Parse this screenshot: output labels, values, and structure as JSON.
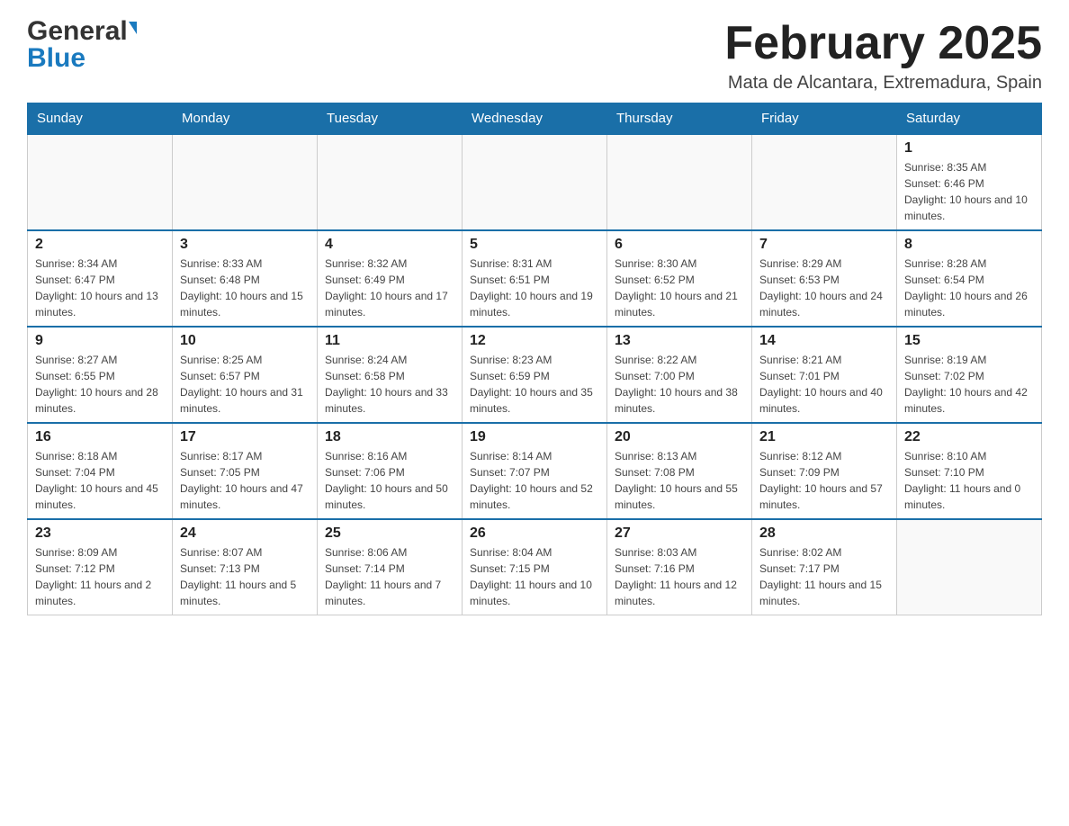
{
  "header": {
    "logo_general": "General",
    "logo_blue": "Blue",
    "month_title": "February 2025",
    "location": "Mata de Alcantara, Extremadura, Spain"
  },
  "weekdays": [
    "Sunday",
    "Monday",
    "Tuesday",
    "Wednesday",
    "Thursday",
    "Friday",
    "Saturday"
  ],
  "weeks": [
    [
      {
        "day": "",
        "info": ""
      },
      {
        "day": "",
        "info": ""
      },
      {
        "day": "",
        "info": ""
      },
      {
        "day": "",
        "info": ""
      },
      {
        "day": "",
        "info": ""
      },
      {
        "day": "",
        "info": ""
      },
      {
        "day": "1",
        "info": "Sunrise: 8:35 AM\nSunset: 6:46 PM\nDaylight: 10 hours and 10 minutes."
      }
    ],
    [
      {
        "day": "2",
        "info": "Sunrise: 8:34 AM\nSunset: 6:47 PM\nDaylight: 10 hours and 13 minutes."
      },
      {
        "day": "3",
        "info": "Sunrise: 8:33 AM\nSunset: 6:48 PM\nDaylight: 10 hours and 15 minutes."
      },
      {
        "day": "4",
        "info": "Sunrise: 8:32 AM\nSunset: 6:49 PM\nDaylight: 10 hours and 17 minutes."
      },
      {
        "day": "5",
        "info": "Sunrise: 8:31 AM\nSunset: 6:51 PM\nDaylight: 10 hours and 19 minutes."
      },
      {
        "day": "6",
        "info": "Sunrise: 8:30 AM\nSunset: 6:52 PM\nDaylight: 10 hours and 21 minutes."
      },
      {
        "day": "7",
        "info": "Sunrise: 8:29 AM\nSunset: 6:53 PM\nDaylight: 10 hours and 24 minutes."
      },
      {
        "day": "8",
        "info": "Sunrise: 8:28 AM\nSunset: 6:54 PM\nDaylight: 10 hours and 26 minutes."
      }
    ],
    [
      {
        "day": "9",
        "info": "Sunrise: 8:27 AM\nSunset: 6:55 PM\nDaylight: 10 hours and 28 minutes."
      },
      {
        "day": "10",
        "info": "Sunrise: 8:25 AM\nSunset: 6:57 PM\nDaylight: 10 hours and 31 minutes."
      },
      {
        "day": "11",
        "info": "Sunrise: 8:24 AM\nSunset: 6:58 PM\nDaylight: 10 hours and 33 minutes."
      },
      {
        "day": "12",
        "info": "Sunrise: 8:23 AM\nSunset: 6:59 PM\nDaylight: 10 hours and 35 minutes."
      },
      {
        "day": "13",
        "info": "Sunrise: 8:22 AM\nSunset: 7:00 PM\nDaylight: 10 hours and 38 minutes."
      },
      {
        "day": "14",
        "info": "Sunrise: 8:21 AM\nSunset: 7:01 PM\nDaylight: 10 hours and 40 minutes."
      },
      {
        "day": "15",
        "info": "Sunrise: 8:19 AM\nSunset: 7:02 PM\nDaylight: 10 hours and 42 minutes."
      }
    ],
    [
      {
        "day": "16",
        "info": "Sunrise: 8:18 AM\nSunset: 7:04 PM\nDaylight: 10 hours and 45 minutes."
      },
      {
        "day": "17",
        "info": "Sunrise: 8:17 AM\nSunset: 7:05 PM\nDaylight: 10 hours and 47 minutes."
      },
      {
        "day": "18",
        "info": "Sunrise: 8:16 AM\nSunset: 7:06 PM\nDaylight: 10 hours and 50 minutes."
      },
      {
        "day": "19",
        "info": "Sunrise: 8:14 AM\nSunset: 7:07 PM\nDaylight: 10 hours and 52 minutes."
      },
      {
        "day": "20",
        "info": "Sunrise: 8:13 AM\nSunset: 7:08 PM\nDaylight: 10 hours and 55 minutes."
      },
      {
        "day": "21",
        "info": "Sunrise: 8:12 AM\nSunset: 7:09 PM\nDaylight: 10 hours and 57 minutes."
      },
      {
        "day": "22",
        "info": "Sunrise: 8:10 AM\nSunset: 7:10 PM\nDaylight: 11 hours and 0 minutes."
      }
    ],
    [
      {
        "day": "23",
        "info": "Sunrise: 8:09 AM\nSunset: 7:12 PM\nDaylight: 11 hours and 2 minutes."
      },
      {
        "day": "24",
        "info": "Sunrise: 8:07 AM\nSunset: 7:13 PM\nDaylight: 11 hours and 5 minutes."
      },
      {
        "day": "25",
        "info": "Sunrise: 8:06 AM\nSunset: 7:14 PM\nDaylight: 11 hours and 7 minutes."
      },
      {
        "day": "26",
        "info": "Sunrise: 8:04 AM\nSunset: 7:15 PM\nDaylight: 11 hours and 10 minutes."
      },
      {
        "day": "27",
        "info": "Sunrise: 8:03 AM\nSunset: 7:16 PM\nDaylight: 11 hours and 12 minutes."
      },
      {
        "day": "28",
        "info": "Sunrise: 8:02 AM\nSunset: 7:17 PM\nDaylight: 11 hours and 15 minutes."
      },
      {
        "day": "",
        "info": ""
      }
    ]
  ]
}
